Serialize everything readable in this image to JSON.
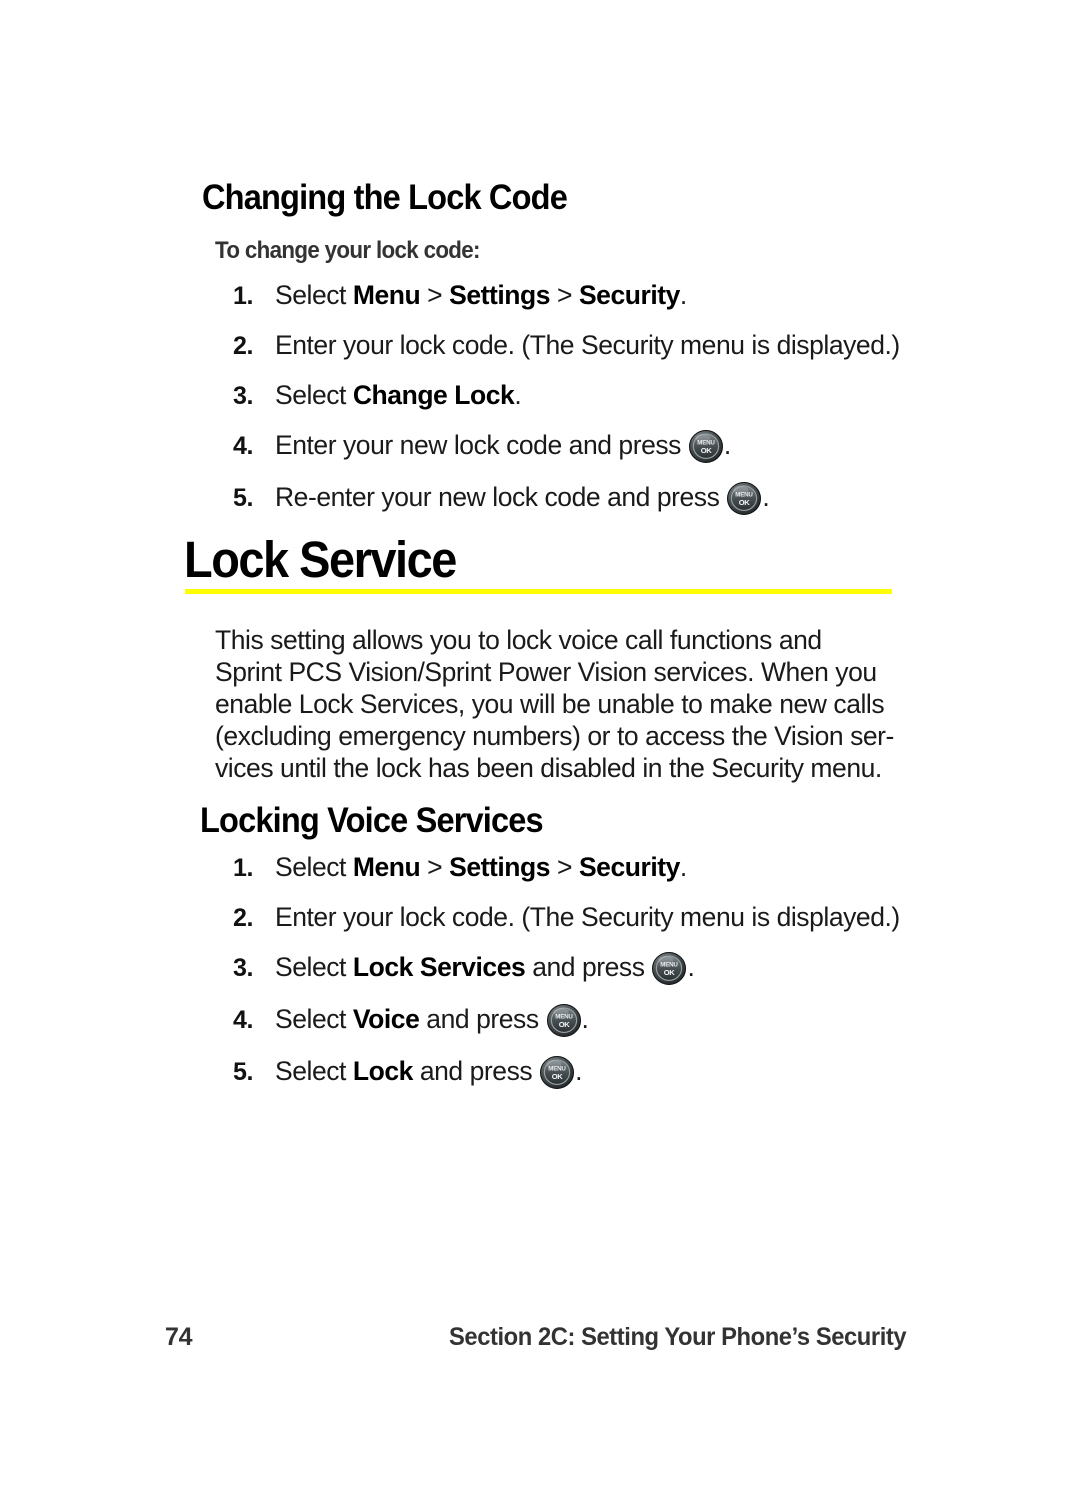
{
  "document": {
    "page_number": "74",
    "footer_section": "Section 2C: Setting Your Phone’s Security",
    "accent_rule_color": "#ffff00"
  },
  "section_change_lock": {
    "heading": "Changing the Lock Code",
    "subheading": "To change your lock code:",
    "steps": [
      {
        "num": "1.",
        "pre": "Select ",
        "bold1": "Menu",
        "mid1": " > ",
        "bold2": "Settings",
        "mid2": " > ",
        "bold3": "Security",
        "post": "."
      },
      {
        "num": "2.",
        "pre": "Enter your lock code. (The Security menu is displayed.)",
        "bold1": "",
        "mid1": "",
        "bold2": "",
        "mid2": "",
        "bold3": "",
        "post": ""
      },
      {
        "num": "3.",
        "pre": "Select ",
        "bold1": "Change Lock",
        "mid1": "",
        "bold2": "",
        "mid2": "",
        "bold3": "",
        "post": "."
      },
      {
        "num": "4.",
        "pre": "Enter your new lock code and press ",
        "bold1": "",
        "mid1": "",
        "bold2": "",
        "mid2": "",
        "bold3": "",
        "post": "."
      },
      {
        "num": "5.",
        "pre": "Re-enter your new lock code and press ",
        "bold1": "",
        "mid1": "",
        "bold2": "",
        "mid2": "",
        "bold3": "",
        "post": "."
      }
    ]
  },
  "section_lock_service": {
    "heading": "Lock Service",
    "body_lines": [
      "This setting allows you to lock voice call functions and",
      "Sprint PCS Vision/Sprint Power Vision services. When you",
      "enable Lock Services, you will be unable to make new calls",
      "(excluding emergency numbers) or to access the Vision ser-",
      "vices until the lock has been disabled in the Security menu."
    ]
  },
  "section_locking_voice": {
    "heading": "Locking Voice Services",
    "steps": [
      {
        "num": "1.",
        "pre": "Select ",
        "bold1": "Menu",
        "mid1": " > ",
        "bold2": "Settings",
        "mid2": " > ",
        "bold3": "Security",
        "post": "."
      },
      {
        "num": "2.",
        "pre": "Enter your lock code. (The Security menu is displayed.)",
        "bold1": "",
        "mid1": "",
        "bold2": "",
        "mid2": "",
        "bold3": "",
        "post": ""
      },
      {
        "num": "3.",
        "pre": "Select ",
        "bold1": "Lock Services",
        "mid1": " and press ",
        "bold2": "",
        "mid2": "",
        "bold3": "",
        "post": "."
      },
      {
        "num": "4.",
        "pre": "Select ",
        "bold1": "Voice",
        "mid1": " and press ",
        "bold2": "",
        "mid2": "",
        "bold3": "",
        "post": "."
      },
      {
        "num": "5.",
        "pre": "Select ",
        "bold1": "Lock",
        "mid1": " and press ",
        "bold2": "",
        "mid2": "",
        "bold3": "",
        "post": "."
      }
    ]
  },
  "icons": {
    "menu_ok_key": {
      "name": "menu-ok-key-icon",
      "label_top": "MENU",
      "label_bottom": "OK"
    }
  }
}
